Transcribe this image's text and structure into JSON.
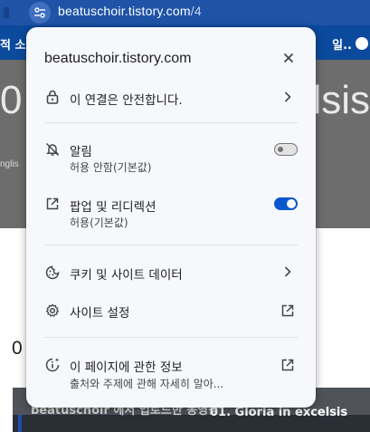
{
  "browser": {
    "url_host": "beatuschoir.tistory.com",
    "url_path": "/4"
  },
  "background_page": {
    "nav_left": "적 소",
    "nav_right": "일..",
    "hero_left": "0",
    "hero_right": "elsis",
    "hero_small": "nglis",
    "section_number": "0",
    "video_title_left": "beatuschoir 에서 업로드한 동영상",
    "video_title_right": "01. Gloria in excelsis"
  },
  "popup": {
    "title": "beatuschoir.tistory.com",
    "connection": {
      "label": "이 연결은 안전합니다."
    },
    "notifications": {
      "label": "알림",
      "sub": "허용 안함(기본값)",
      "enabled": false
    },
    "popups": {
      "label": "팝업 및 리디렉션",
      "sub": "허용(기본값)",
      "enabled": true
    },
    "cookies": {
      "label": "쿠키 및 사이트 데이터"
    },
    "site_settings": {
      "label": "사이트 설정"
    },
    "page_info": {
      "label": "이 페이지에 관한 정보",
      "sub": "출처와 주제에 관해 자세히 알아..."
    }
  },
  "colors": {
    "accent": "#0b57d0",
    "address_bar": "#1f53a8",
    "popup_bg": "#f6f8fc"
  },
  "icons": {
    "site_info": "tune-icon",
    "close": "close-icon",
    "lock": "lock-icon",
    "notifications": "bell-off-icon",
    "popups": "open-in-new-icon",
    "cookies": "cookie-icon",
    "settings": "gear-icon",
    "page_info": "info-sparkle-icon",
    "chevron": "chevron-right-icon",
    "external": "external-link-icon"
  }
}
